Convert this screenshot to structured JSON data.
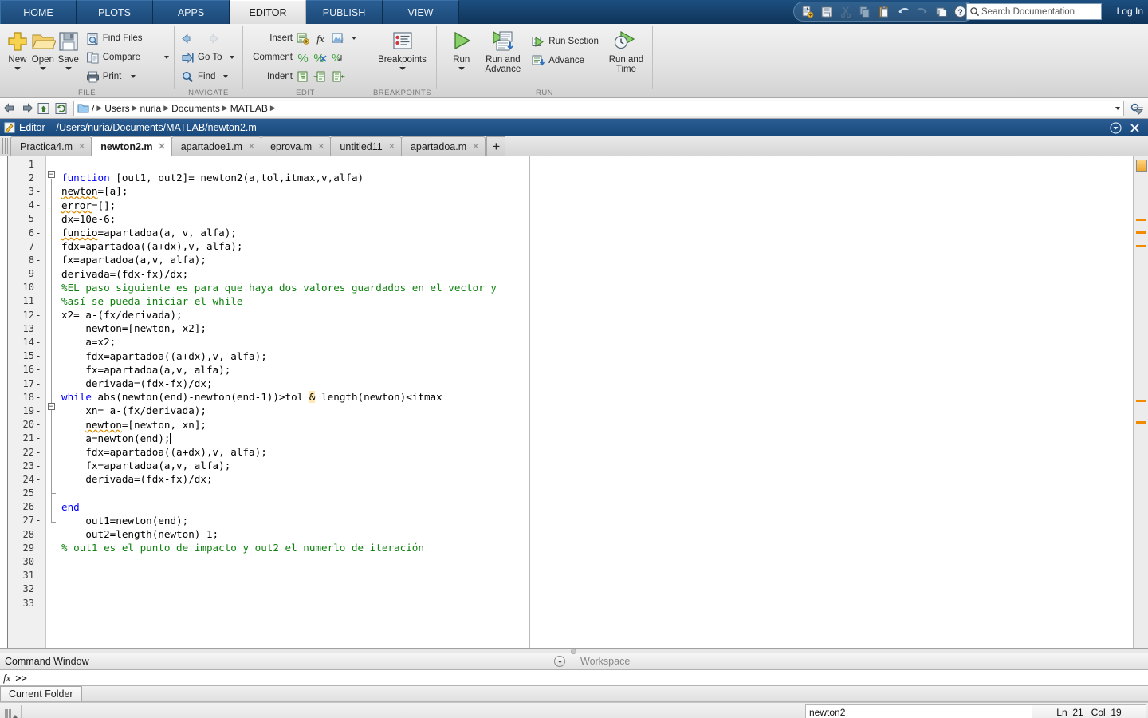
{
  "window": {
    "ribbon_tabs": [
      "HOME",
      "PLOTS",
      "APPS",
      "EDITOR",
      "PUBLISH",
      "VIEW"
    ],
    "active_ribbon_tab": "EDITOR",
    "login_label": "Log In"
  },
  "quick_access": {
    "icons": [
      "new-script-icon",
      "save-icon",
      "cut-icon",
      "copy-icon",
      "paste-icon",
      "undo-icon",
      "redo-icon",
      "switch-window-icon",
      "help-icon"
    ],
    "search": {
      "placeholder": "Search Documentation",
      "value": ""
    }
  },
  "ribbon": {
    "groups": [
      {
        "name": "FILE",
        "label": "FILE",
        "big_buttons": [
          {
            "label": "New",
            "icon": "new-file-icon",
            "has_menu": true
          },
          {
            "label": "Open",
            "icon": "open-folder-icon",
            "has_menu": true
          },
          {
            "label": "Save",
            "icon": "save-disk-icon",
            "has_menu": true
          }
        ],
        "small_buttons": [
          {
            "label": "Find Files",
            "icon": "find-files-icon",
            "has_menu": false
          },
          {
            "label": "Compare",
            "icon": "compare-icon",
            "has_menu": true
          },
          {
            "label": "Print",
            "icon": "print-icon",
            "has_menu": true
          }
        ]
      },
      {
        "name": "NAVIGATE",
        "label": "NAVIGATE",
        "small_buttons": [
          {
            "label": "",
            "icon": "back-arrow-icon",
            "has_menu": false
          },
          {
            "label": "Go To",
            "icon": "go-to-icon",
            "has_menu": true
          },
          {
            "label": "Find",
            "icon": "find-icon",
            "has_menu": true
          }
        ]
      },
      {
        "name": "EDIT",
        "label": "EDIT",
        "rows": [
          {
            "label": "Insert",
            "icons": [
              "insert-section-icon",
              "insert-function-icon",
              "insert-figure-icon"
            ],
            "has_menu": true
          },
          {
            "label": "Comment",
            "icons": [
              "comment-icon",
              "uncomment-icon",
              "wrap-comment-icon"
            ],
            "has_menu": false
          },
          {
            "label": "Indent",
            "icons": [
              "smart-indent-icon",
              "indent-right-icon",
              "indent-left-icon"
            ],
            "has_menu": false
          }
        ]
      },
      {
        "name": "BREAKPOINTS",
        "label": "BREAKPOINTS",
        "big_buttons": [
          {
            "label": "Breakpoints",
            "icon": "breakpoints-icon",
            "has_menu": true
          }
        ]
      },
      {
        "name": "RUN",
        "label": "RUN",
        "big_buttons": [
          {
            "label": "Run",
            "icon": "run-icon",
            "has_menu": true
          },
          {
            "label": "Run and\nAdvance",
            "icon": "run-and-advance-icon",
            "has_menu": false
          },
          {
            "label": "Run and\nTime",
            "icon": "run-and-time-icon",
            "has_menu": false
          }
        ],
        "small_buttons": [
          {
            "label": "Run Section",
            "icon": "run-section-icon",
            "has_menu": false
          },
          {
            "label": "Advance",
            "icon": "advance-icon",
            "has_menu": false
          }
        ]
      }
    ]
  },
  "pathbar": {
    "folder_icon": "folder-icon",
    "root": "/",
    "crumbs": [
      "Users",
      "nuria",
      "Documents",
      "MATLAB"
    ]
  },
  "editor": {
    "title": "Editor – /Users/nuria/Documents/MATLAB/newton2.m",
    "title_icon": "editor-icon",
    "file_tabs": [
      {
        "label": "Practica4.m",
        "active": false
      },
      {
        "label": "newton2.m",
        "active": true
      },
      {
        "label": "apartadoe1.m",
        "active": false
      },
      {
        "label": "eprova.m",
        "active": false
      },
      {
        "label": "untitled11",
        "active": false
      },
      {
        "label": "apartadoa.m",
        "active": false
      }
    ],
    "new_tab_label": "+",
    "total_lines": 33,
    "lines": [
      {
        "n": 1,
        "exec": false,
        "text": ""
      },
      {
        "n": 2,
        "exec": false,
        "text": "function [out1, out2]= newton2(a,tol,itmax,v,alfa)"
      },
      {
        "n": 3,
        "exec": true,
        "text": "newton=[a];"
      },
      {
        "n": 4,
        "exec": true,
        "text": "error=[];"
      },
      {
        "n": 5,
        "exec": true,
        "text": "dx=10e-6;"
      },
      {
        "n": 6,
        "exec": true,
        "text": "funcio=apartadoa(a, v, alfa);"
      },
      {
        "n": 7,
        "exec": true,
        "text": "fdx=apartadoa((a+dx),v, alfa);"
      },
      {
        "n": 8,
        "exec": true,
        "text": "fx=apartadoa(a,v, alfa);"
      },
      {
        "n": 9,
        "exec": true,
        "text": "derivada=(fdx-fx)/dx;"
      },
      {
        "n": 10,
        "exec": false,
        "text": "%EL paso siguiente es para que haya dos valores guardados en el vector y"
      },
      {
        "n": 11,
        "exec": false,
        "text": "%así se pueda iniciar el while"
      },
      {
        "n": 12,
        "exec": true,
        "text": "x2= a-(fx/derivada);"
      },
      {
        "n": 13,
        "exec": true,
        "text": "    newton=[newton, x2];"
      },
      {
        "n": 14,
        "exec": true,
        "text": "    a=x2;"
      },
      {
        "n": 15,
        "exec": true,
        "text": "    fdx=apartadoa((a+dx),v, alfa);"
      },
      {
        "n": 16,
        "exec": true,
        "text": "    fx=apartadoa(a,v, alfa);"
      },
      {
        "n": 17,
        "exec": true,
        "text": "    derivada=(fdx-fx)/dx;"
      },
      {
        "n": 18,
        "exec": true,
        "text": "while abs(newton(end)-newton(end-1))>tol & length(newton)<itmax"
      },
      {
        "n": 19,
        "exec": true,
        "text": "    xn= a-(fx/derivada);"
      },
      {
        "n": 20,
        "exec": true,
        "text": "    newton=[newton, xn];"
      },
      {
        "n": 21,
        "exec": true,
        "text": "    a=newton(end);"
      },
      {
        "n": 22,
        "exec": true,
        "text": "    fdx=apartadoa((a+dx),v, alfa);"
      },
      {
        "n": 23,
        "exec": true,
        "text": "    fx=apartadoa(a,v, alfa);"
      },
      {
        "n": 24,
        "exec": true,
        "text": "    derivada=(fdx-fx)/dx;"
      },
      {
        "n": 25,
        "exec": false,
        "text": ""
      },
      {
        "n": 26,
        "exec": true,
        "text": "end"
      },
      {
        "n": 27,
        "exec": true,
        "text": "    out1=newton(end);"
      },
      {
        "n": 28,
        "exec": true,
        "text": "    out2=length(newton)-1;"
      },
      {
        "n": 29,
        "exec": false,
        "text": "% out1 es el punto de impacto y out2 el numerlo de iteración"
      },
      {
        "n": 30,
        "exec": false,
        "text": ""
      },
      {
        "n": 31,
        "exec": false,
        "text": ""
      },
      {
        "n": 32,
        "exec": false,
        "text": ""
      },
      {
        "n": 33,
        "exec": false,
        "text": ""
      }
    ],
    "analyzer_marks": [
      223,
      239,
      256,
      450,
      477
    ]
  },
  "command_window": {
    "title": "Command Window",
    "prompt": ">>",
    "fx_label": "fx"
  },
  "workspace": {
    "title": "Workspace"
  },
  "current_folder": {
    "title": "Current Folder"
  },
  "status_bar": {
    "file": "newton2",
    "ln_label": "Ln",
    "ln_value": "21",
    "col_label": "Col",
    "col_value": "19"
  },
  "colors": {
    "ribbon_blue": "#16416c",
    "active_tab": "#e4e4e4",
    "keyword": "#0000ff",
    "comment": "#108010",
    "warning": "#f08a00",
    "title_bar": "#1f5288"
  }
}
